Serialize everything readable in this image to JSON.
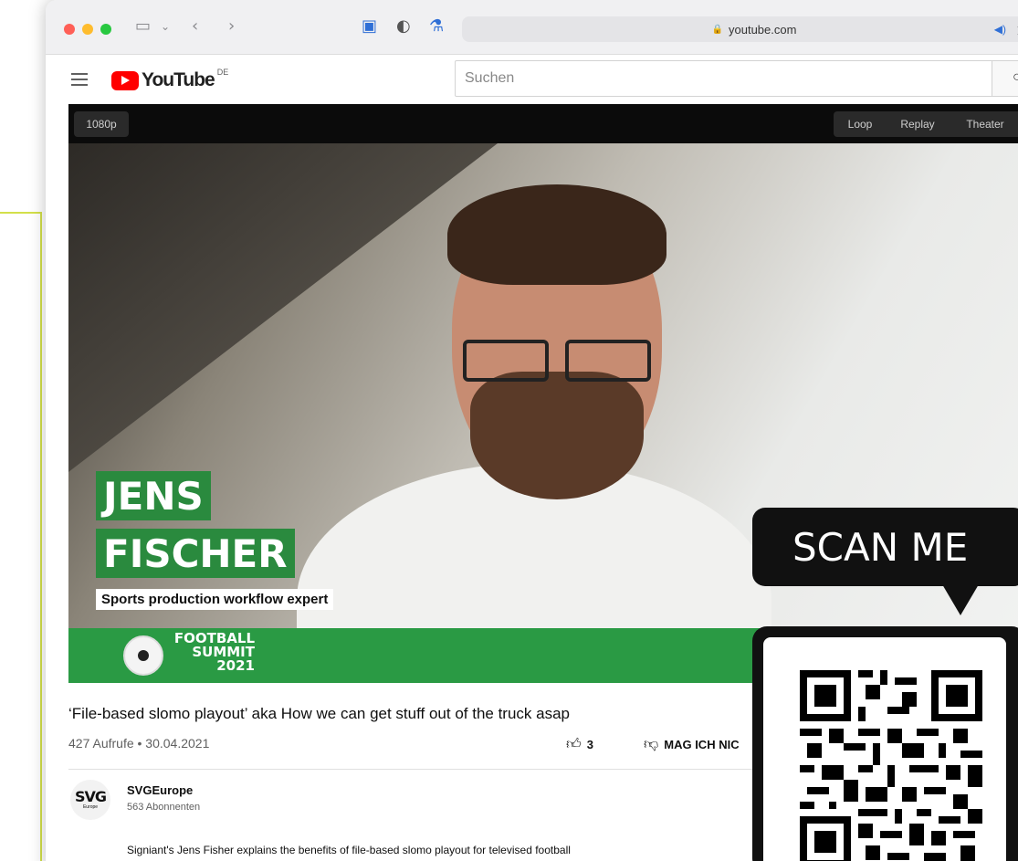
{
  "browser": {
    "url": "youtube.com",
    "toolbar_icons": [
      "sidebar-icon",
      "chevron-down-icon",
      "back-icon",
      "forward-icon",
      "extension-icon",
      "shield-icon",
      "bottle-icon",
      "lock-icon",
      "speaker-icon",
      "translate-icon",
      "reload-icon"
    ],
    "traffic_colors": [
      "#ff5f57",
      "#febc2e",
      "#28c840"
    ]
  },
  "youtube": {
    "logo_text": "YouTube",
    "region": "DE",
    "search_placeholder": "Suchen"
  },
  "player": {
    "quality": "1080p",
    "controls": [
      "Loop",
      "Replay",
      "Theater"
    ],
    "lower_third": {
      "first_name": "JENS",
      "last_name": "FISCHER",
      "role": "Sports production workflow expert"
    },
    "event": {
      "line1": "FOOTBALL",
      "line2": "SUMMIT",
      "line3": "2021"
    }
  },
  "video": {
    "title": "‘File-based slomo playout’ aka How we can get stuff out of the truck asap",
    "meta": "427 Aufrufe • 30.04.2021",
    "likes": "3",
    "dislike_label": "MAG ICH NIC"
  },
  "channel": {
    "name": "SVGEurope",
    "subscribers": "563 Abonnenten",
    "logo_text": "SVG",
    "logo_sub": "Europe",
    "description": "Signiant's Jens Fisher explains the benefits of file-based slomo playout for televised football"
  },
  "overlay": {
    "scan_label": "SCAN ME"
  },
  "colors": {
    "brand_green": "#2a8a3e",
    "youtube_red": "#ff0000",
    "lime_frame": "#d3e04a"
  }
}
